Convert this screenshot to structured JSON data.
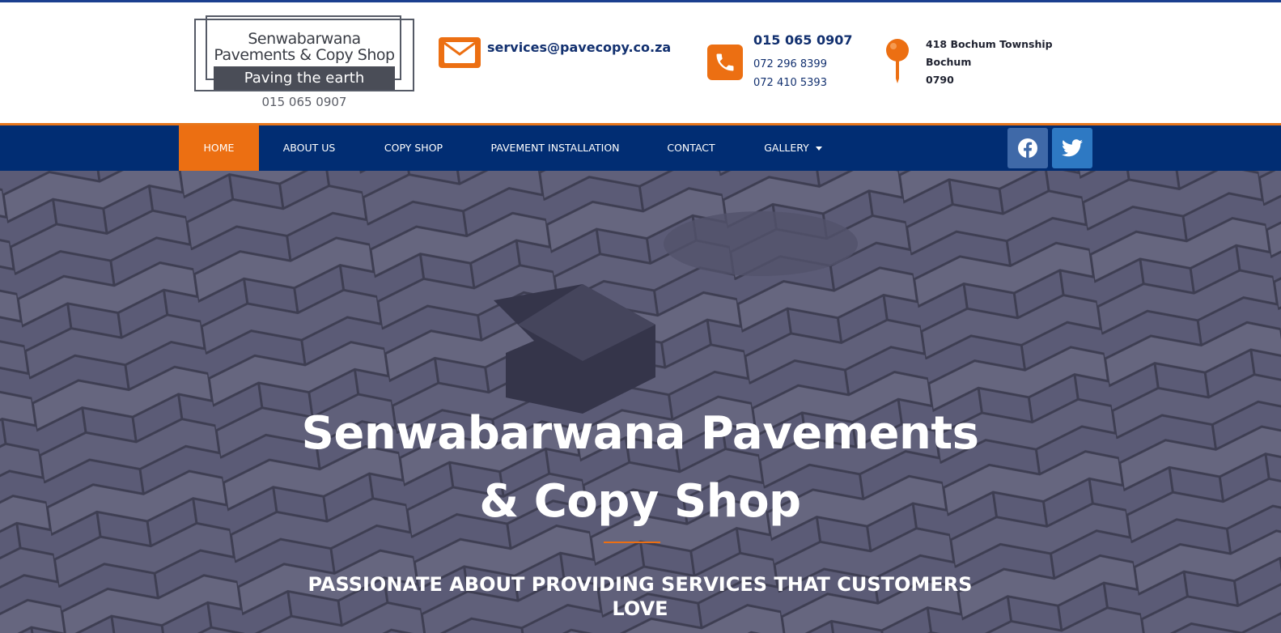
{
  "logo": {
    "line1": "Senwabarwana",
    "line2": "Pavements & Copy Shop",
    "tagline": "Paving the earth",
    "phone": "015 065 0907"
  },
  "contact": {
    "email": "services@pavecopy.co.za",
    "phone_main": "015 065 0907",
    "phone_alt_1": "072 296 8399",
    "phone_alt_2": "072 410 5393",
    "address_line_1": "418 Bochum Township",
    "address_line_2": "Bochum",
    "address_line_3": "0790"
  },
  "nav": {
    "items": [
      {
        "label": "HOME",
        "active": true
      },
      {
        "label": "ABOUT US"
      },
      {
        "label": "COPY SHOP"
      },
      {
        "label": "PAVEMENT INSTALLATION"
      },
      {
        "label": "CONTACT"
      },
      {
        "label": "GALLERY"
      }
    ],
    "social": [
      "facebook-icon",
      "twitter-icon"
    ]
  },
  "hero": {
    "title_line_1": "Senwabarwana Pavements",
    "title_line_2": "& Copy Shop",
    "subtitle_line_1": "PASSIONATE ABOUT PROVIDING SERVICES THAT CUSTOMERS",
    "subtitle_line_2": "LOVE"
  },
  "colors": {
    "accent_orange": "#ec6f12",
    "nav_blue": "#012d73",
    "text_blue": "#12306f",
    "hero_overlay": "#5a5a74"
  }
}
